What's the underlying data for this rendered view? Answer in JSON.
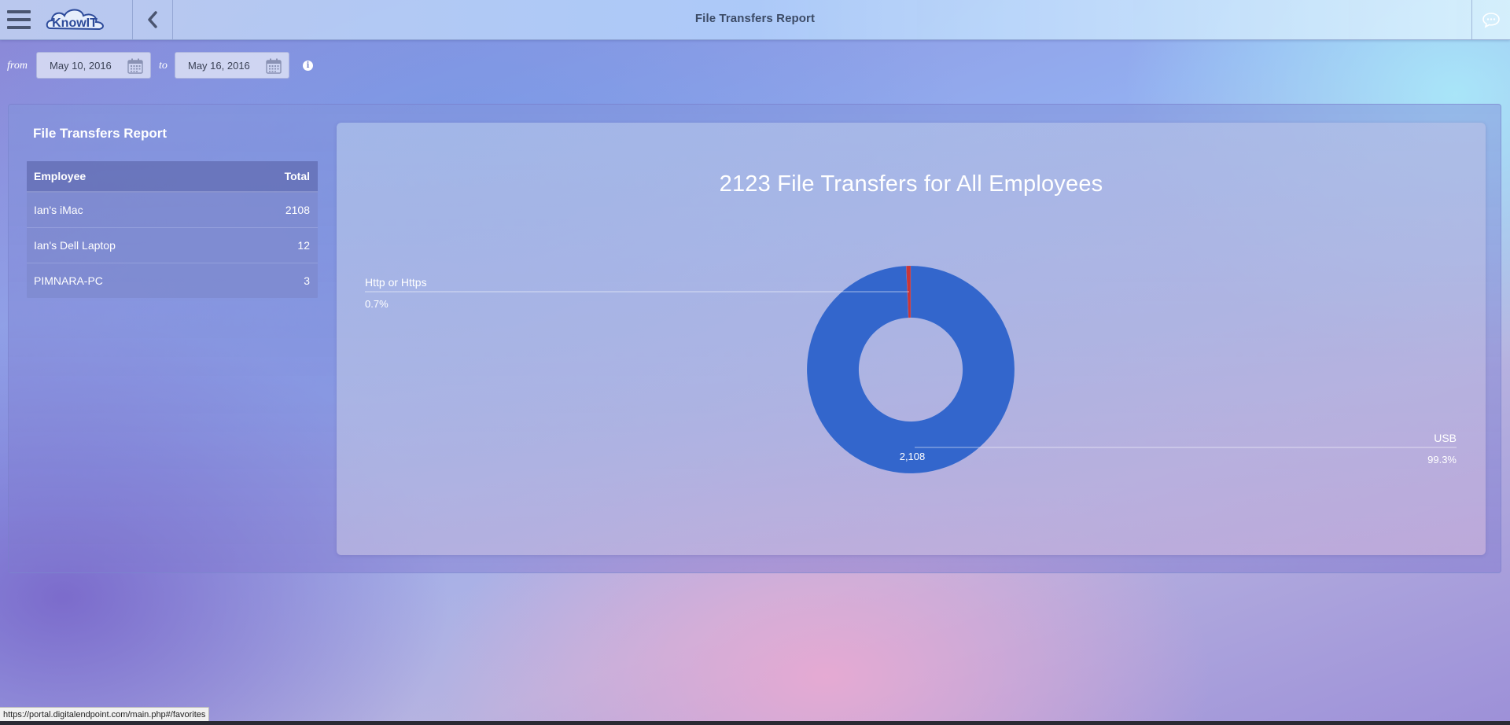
{
  "header": {
    "title": "File Transfers Report",
    "logo_text": "KnowIT",
    "menu_icon": "hamburger-icon",
    "back_icon": "chevron-left-icon",
    "chat_icon": "chat-bubble-icon"
  },
  "filters": {
    "from_label": "from",
    "to_label": "to",
    "from_date": "May 10, 2016",
    "to_date": "May 16, 2016",
    "calendar_icon": "calendar-icon",
    "info_icon": "info-icon"
  },
  "report": {
    "title": "File Transfers Report",
    "table": {
      "columns": [
        "Employee",
        "Total"
      ],
      "rows": [
        {
          "employee": "Ian's iMac",
          "total": "2108"
        },
        {
          "employee": "Ian's Dell Laptop",
          "total": "12"
        },
        {
          "employee": "PIMNARA-PC",
          "total": "3"
        }
      ]
    }
  },
  "chart_data": {
    "type": "pie",
    "title": "2123 File Transfers for All Employees",
    "donut": true,
    "slices": [
      {
        "label": "Http or Https",
        "value": 15,
        "percent": "0.7%",
        "color": "#c8373a"
      },
      {
        "label": "USB",
        "value": 2108,
        "percent": "99.3%",
        "color": "#3366cc",
        "data_label": "2,108"
      }
    ]
  },
  "status_bar": {
    "url": "https://portal.digitalendpoint.com/main.php#/favorites"
  }
}
